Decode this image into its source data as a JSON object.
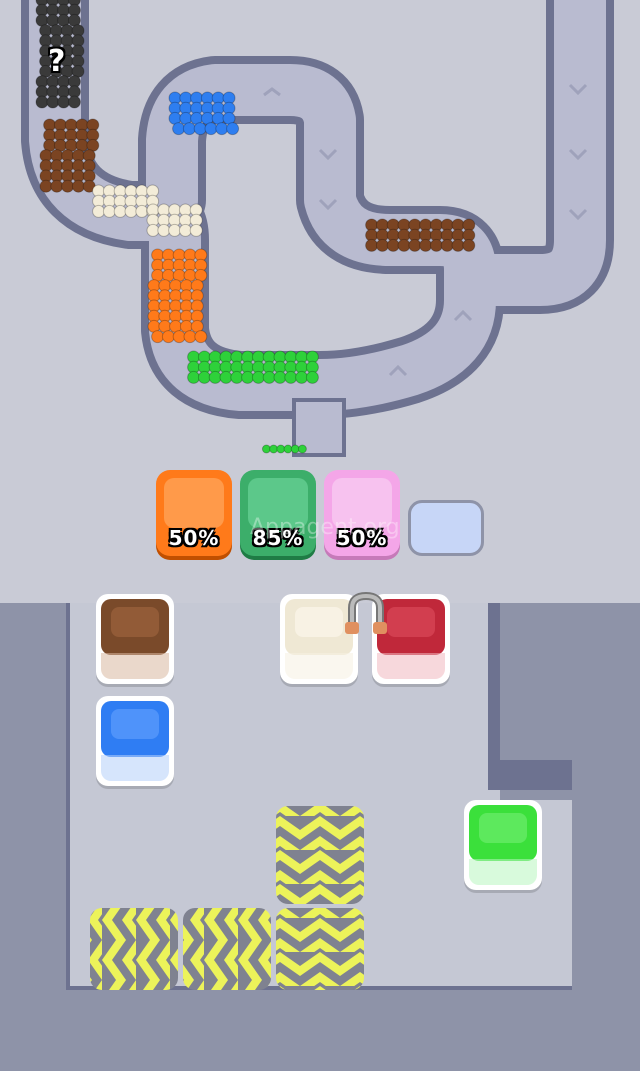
{
  "mystery_marker": "?",
  "watermark": "Appagent.org",
  "collector_slots": [
    {
      "name": "orange",
      "color": "#ff7a1a",
      "percent": "50%"
    },
    {
      "name": "green",
      "color": "#3cae6a",
      "percent": "85%"
    },
    {
      "name": "pink",
      "color": "#f4a6e8",
      "percent": "50%"
    },
    {
      "name": "empty",
      "color": "#c7d6f7",
      "percent": ""
    }
  ],
  "cups": [
    {
      "name": "brown",
      "color": "#7a4a2a"
    },
    {
      "name": "blue",
      "color": "#2f7df3"
    },
    {
      "name": "cream",
      "color": "#efe8d4"
    },
    {
      "name": "red",
      "color": "#c0283a"
    },
    {
      "name": "green",
      "color": "#3be03b"
    }
  ],
  "ball_colors": {
    "black": "#3a3a3a",
    "brown": "#7b4422",
    "cream": "#f3ecd8",
    "orange": "#ff7a1a",
    "green": "#2ed13a",
    "blue": "#2e7ef0"
  }
}
